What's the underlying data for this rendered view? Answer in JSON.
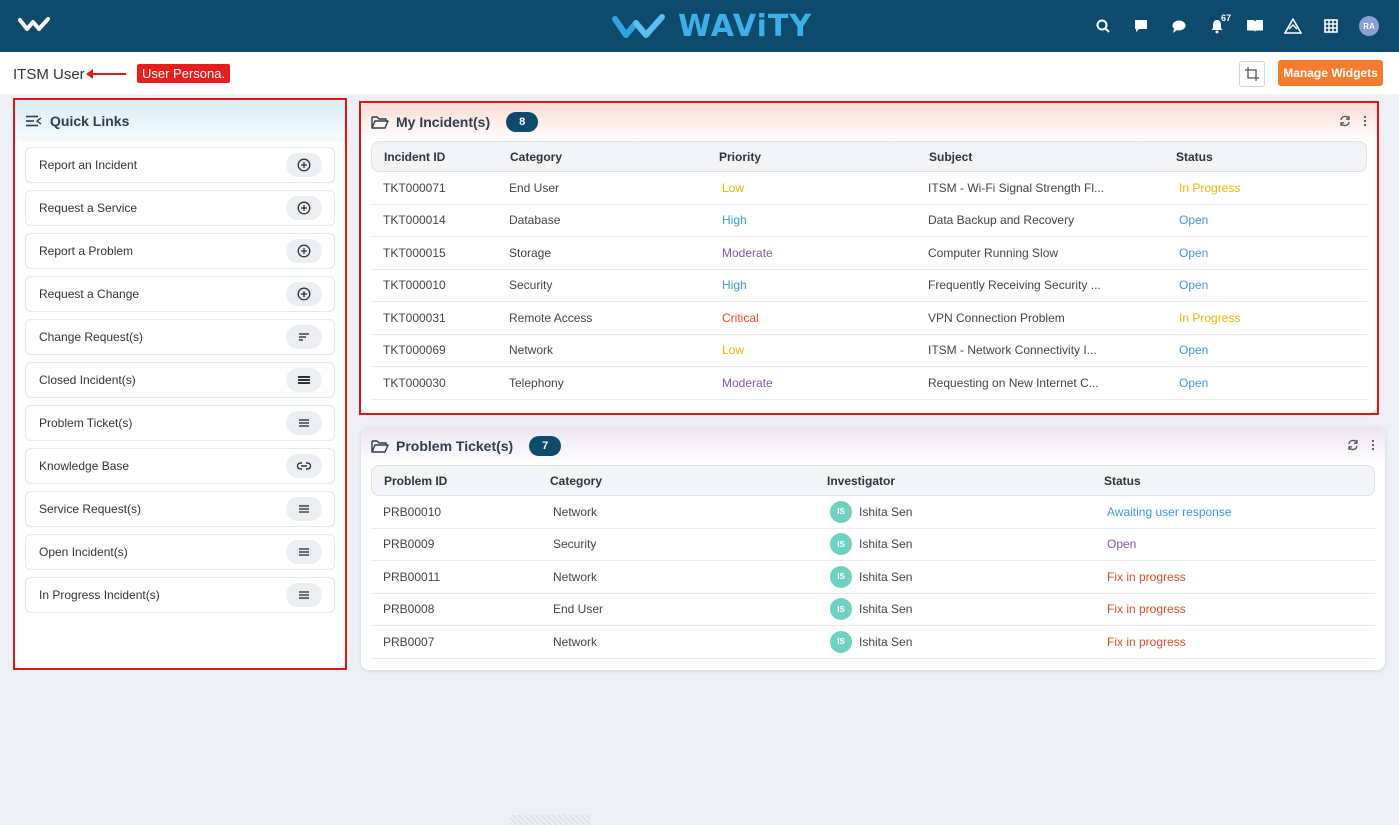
{
  "header": {
    "brand": "WAViTY",
    "notifications_count": "67",
    "user_initials": "RA",
    "icons": [
      "menu-logo-icon",
      "search-icon",
      "message-square-icon",
      "chat-bubble-icon",
      "bell-icon",
      "book-icon",
      "triangle-icon",
      "grid-icon"
    ]
  },
  "subheader": {
    "title": "ITSM User",
    "annotation": "User Persona.",
    "manage_widgets_label": "Manage Widgets"
  },
  "quick_links": {
    "title": "Quick Links",
    "items": [
      {
        "label": "Report an Incident",
        "icon": "plus-circle-icon"
      },
      {
        "label": "Request a Service",
        "icon": "plus-circle-icon"
      },
      {
        "label": "Report a Problem",
        "icon": "plus-circle-icon"
      },
      {
        "label": "Request a Change",
        "icon": "plus-circle-icon"
      },
      {
        "label": "Change Request(s)",
        "icon": "sort-lines-icon"
      },
      {
        "label": "Closed Incident(s)",
        "icon": "list-icon"
      },
      {
        "label": "Problem Ticket(s)",
        "icon": "menu-lines-icon"
      },
      {
        "label": "Knowledge Base",
        "icon": "link-icon"
      },
      {
        "label": "Service Request(s)",
        "icon": "menu-lines-icon"
      },
      {
        "label": "Open Incident(s)",
        "icon": "menu-lines-icon"
      },
      {
        "label": "In Progress Incident(s)",
        "icon": "menu-lines-icon"
      }
    ]
  },
  "incidents": {
    "title": "My Incident(s)",
    "count": "8",
    "columns": [
      "Incident ID",
      "Category",
      "Priority",
      "Subject",
      "Status"
    ],
    "rows": [
      {
        "id": "TKT000071",
        "category": "End User",
        "priority": "Low",
        "subject": "ITSM - Wi-Fi Signal Strength Fl...",
        "status": "In Progress"
      },
      {
        "id": "TKT000014",
        "category": "Database",
        "priority": "High",
        "subject": "Data Backup and Recovery",
        "status": "Open"
      },
      {
        "id": "TKT000015",
        "category": "Storage",
        "priority": "Moderate",
        "subject": "Computer Running Slow",
        "status": "Open"
      },
      {
        "id": "TKT000010",
        "category": "Security",
        "priority": "High",
        "subject": "Frequently Receiving Security ...",
        "status": "Open"
      },
      {
        "id": "TKT000031",
        "category": "Remote Access",
        "priority": "Critical",
        "subject": "VPN Connection Problem",
        "status": "In Progress"
      },
      {
        "id": "TKT000069",
        "category": "Network",
        "priority": "Low",
        "subject": "ITSM - Network Connectivity I...",
        "status": "Open"
      },
      {
        "id": "TKT000030",
        "category": "Telephony",
        "priority": "Moderate",
        "subject": "Requesting on New Internet C...",
        "status": "Open"
      }
    ]
  },
  "problems": {
    "title": "Problem Ticket(s)",
    "count": "7",
    "columns": [
      "Problem ID",
      "Category",
      "Investigator",
      "Status"
    ],
    "rows": [
      {
        "id": "PRB00010",
        "category": "Network",
        "investigator_initials": "IS",
        "investigator": "Ishita Sen",
        "status": "Awaiting user response"
      },
      {
        "id": "PRB0009",
        "category": "Security",
        "investigator_initials": "IS",
        "investigator": "Ishita Sen",
        "status": "Open"
      },
      {
        "id": "PRB00011",
        "category": "Network",
        "investigator_initials": "IS",
        "investigator": "Ishita Sen",
        "status": "Fix in progress"
      },
      {
        "id": "PRB0008",
        "category": "End User",
        "investigator_initials": "IS",
        "investigator": "Ishita Sen",
        "status": "Fix in progress"
      },
      {
        "id": "PRB0007",
        "category": "Network",
        "investigator_initials": "IS",
        "investigator": "Ishita Sen",
        "status": "Fix in progress"
      }
    ]
  },
  "colors": {
    "header_bg": "#0e4a6b",
    "brand": "#3cb0e8",
    "priority": {
      "Low": "#f0b400",
      "High": "#3a9ad9",
      "Moderate": "#7d5ba6",
      "Critical": "#e04a2a"
    },
    "status": {
      "In Progress": "#f0b400",
      "Open": "#3a9ad9",
      "Awaiting user response": "#3a9ad9",
      "Open-problem": "#7d5ba6",
      "Fix in progress": "#e04a2a"
    }
  }
}
